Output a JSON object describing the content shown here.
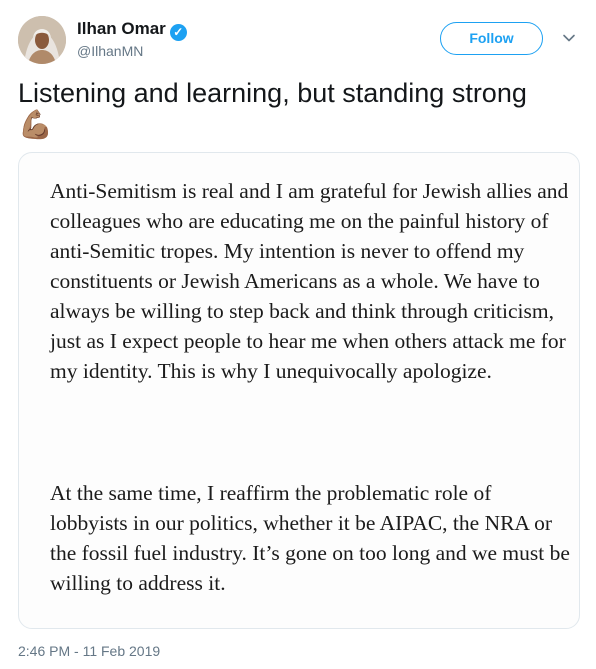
{
  "author": {
    "name": "Ilhan Omar",
    "handle": "@IlhanMN"
  },
  "follow_label": "Follow",
  "tweet_text": "Listening and learning, but standing strong",
  "tweet_emoji": "💪🏽",
  "statement": {
    "paragraph1": "Anti-Semitism is real and I am grateful for Jewish allies and colleagues who are educating me on the painful history of anti-Semitic tropes. My intention is never to offend my constituents or Jewish Americans as a whole. We have to always be willing to step back and think through criticism, just as I expect people to hear me when others attack me for my identity. This is why I unequivocally apologize.",
    "paragraph2": "At the same time, I reaffirm the problematic role of lobbyists in our politics, whether it be AIPAC, the NRA or the fossil fuel industry. It’s gone on too long and we must be willing to address it."
  },
  "timestamp": "2:46 PM - 11 Feb 2019",
  "colors": {
    "accent": "#1da1f2",
    "muted": "#657786",
    "text": "#14171a"
  },
  "icons": {
    "verified": "verified-badge-icon",
    "caret": "chevron-down-icon"
  }
}
